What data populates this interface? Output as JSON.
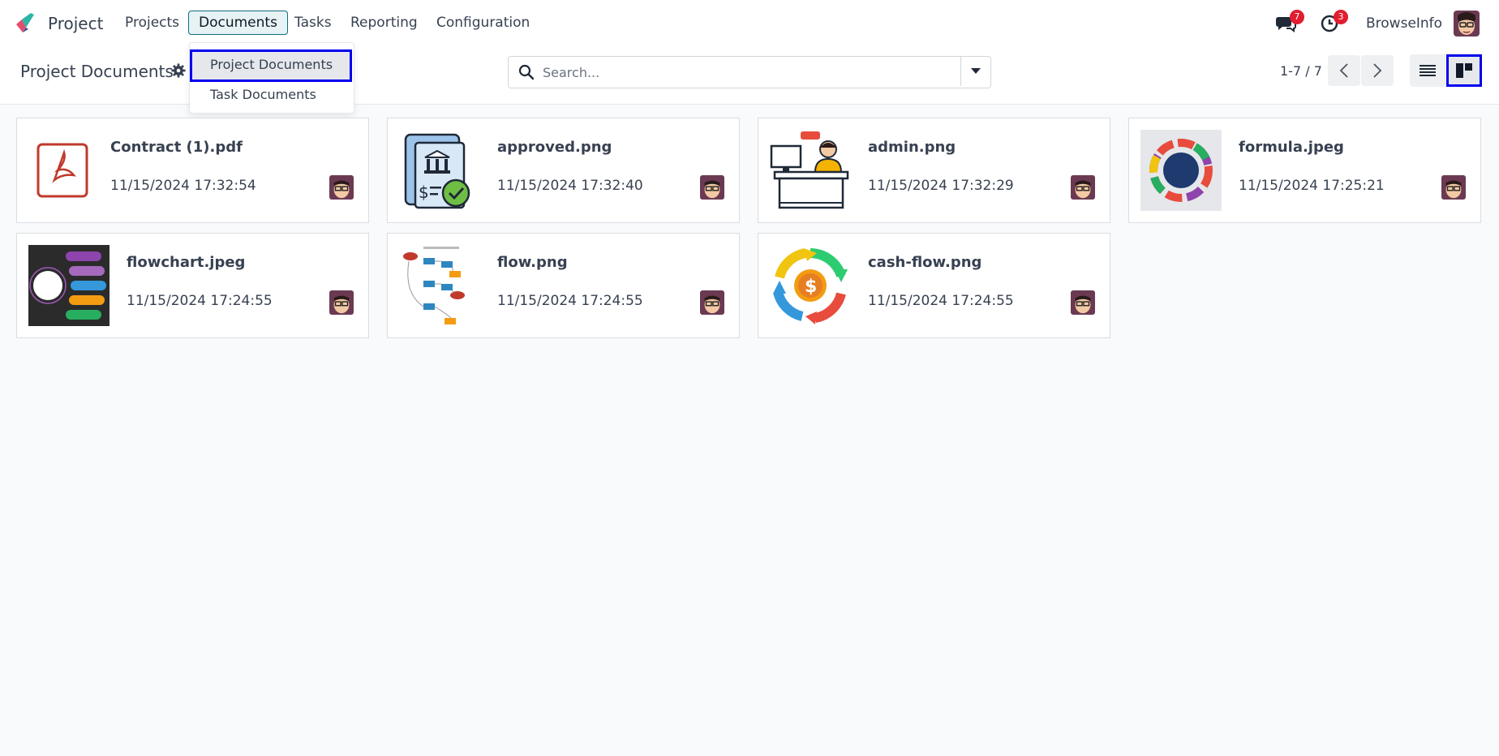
{
  "app": {
    "name": "Project"
  },
  "nav": {
    "menus": [
      "Projects",
      "Documents",
      "Tasks",
      "Reporting",
      "Configuration"
    ],
    "active_menu": "Documents",
    "messages_count": "7",
    "activities_count": "3",
    "user_name": "BrowseInfo"
  },
  "dropdown": {
    "items": [
      "Project Documents",
      "Task Documents"
    ]
  },
  "control": {
    "title": "Project Documents",
    "search_placeholder": "Search...",
    "pager": "1-7 / 7"
  },
  "documents": [
    {
      "name": "Contract (1).pdf",
      "date": "11/15/2024 17:32:54",
      "thumb": "pdf-icon"
    },
    {
      "name": "approved.png",
      "date": "11/15/2024 17:32:40",
      "thumb": "approved-document-icon"
    },
    {
      "name": "admin.png",
      "date": "11/15/2024 17:32:29",
      "thumb": "admin-desk-illustration"
    },
    {
      "name": "formula.jpeg",
      "date": "11/15/2024 17:25:21",
      "thumb": "research-wheel-image"
    },
    {
      "name": "flowchart.jpeg",
      "date": "11/15/2024 17:24:55",
      "thumb": "flowchart-image"
    },
    {
      "name": "flow.png",
      "date": "11/15/2024 17:24:55",
      "thumb": "flow-diagram-image"
    },
    {
      "name": "cash-flow.png",
      "date": "11/15/2024 17:24:55",
      "thumb": "cash-flow-icon"
    }
  ],
  "colors": {
    "accent": "#0f6e7f",
    "highlight_border": "#0000ee",
    "badge": "#e11d2f"
  }
}
